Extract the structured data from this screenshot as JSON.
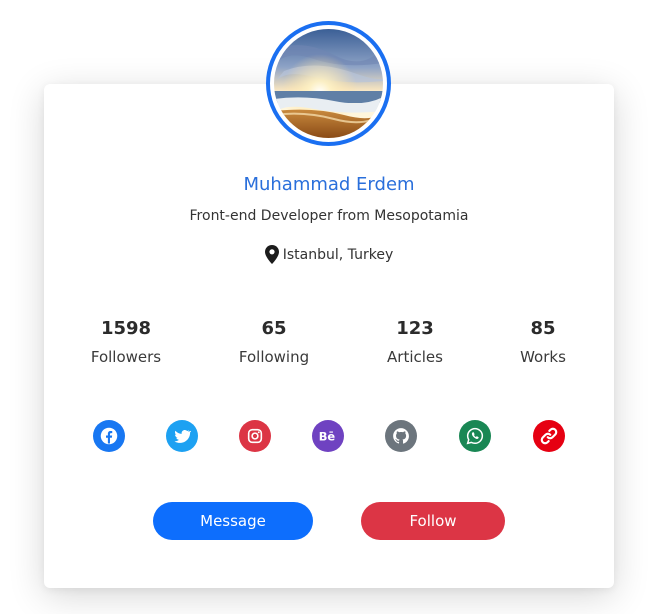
{
  "profile": {
    "name": "Muhammad Erdem",
    "title": "Front-end Developer from Mesopotamia",
    "location": "Istanbul, Turkey"
  },
  "stats": [
    {
      "value": "1598",
      "label": "Followers"
    },
    {
      "value": "65",
      "label": "Following"
    },
    {
      "value": "123",
      "label": "Articles"
    },
    {
      "value": "85",
      "label": "Works"
    }
  ],
  "social": [
    {
      "icon": "facebook-icon",
      "color": "#1877f2"
    },
    {
      "icon": "twitter-icon",
      "color": "#1da1f2"
    },
    {
      "icon": "instagram-icon",
      "color": "#dc3545"
    },
    {
      "icon": "behance-icon",
      "color": "#6f42c1"
    },
    {
      "icon": "github-icon",
      "color": "#6c757d"
    },
    {
      "icon": "whatsapp-icon",
      "color": "#198754"
    },
    {
      "icon": "link-icon",
      "color": "#e60012"
    }
  ],
  "actions": {
    "message_label": "Message",
    "follow_label": "Follow",
    "message_color": "#0d6efd",
    "follow_color": "#dc3545"
  },
  "theme": {
    "accent": "#1a6ff1",
    "name_color": "#2a6fdb"
  }
}
